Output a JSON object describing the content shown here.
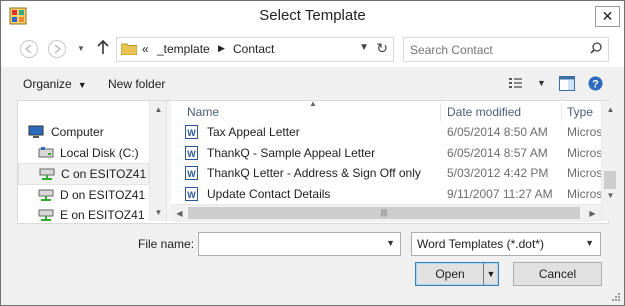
{
  "window": {
    "title": "Select Template",
    "close_glyph": "✕"
  },
  "nav": {
    "back_icon": "back-arrow-icon",
    "forward_icon": "forward-arrow-icon",
    "up_icon": "up-arrow-icon",
    "breadcrumb": [
      "«",
      "_template",
      "Contact"
    ],
    "search_placeholder": "Search Contact"
  },
  "toolbar": {
    "organize_label": "Organize",
    "new_folder_label": "New folder"
  },
  "navpane": {
    "items": [
      {
        "label": "Computer",
        "icon": "computer-icon"
      },
      {
        "label": "Local Disk (C:)",
        "icon": "drive-icon"
      },
      {
        "label": "C on ESITOZ41",
        "icon": "network-drive-icon",
        "selected": true
      },
      {
        "label": "D on ESITOZ41",
        "icon": "network-drive-icon"
      },
      {
        "label": "E on ESITOZ41",
        "icon": "network-drive-icon"
      }
    ]
  },
  "filelist": {
    "columns": [
      "Name",
      "Date modified",
      "Type"
    ],
    "rows": [
      {
        "name": "Tax Appeal Letter",
        "date": "6/05/2014 8:50 AM",
        "type": "Micros"
      },
      {
        "name": "ThankQ - Sample Appeal Letter",
        "date": "6/05/2014 8:57 AM",
        "type": "Micros"
      },
      {
        "name": "ThankQ Letter - Address & Sign Off only",
        "date": "5/03/2012 4:42 PM",
        "type": "Micros"
      },
      {
        "name": "Update Contact Details",
        "date": "9/11/2007 11:27 AM",
        "type": "Micros"
      }
    ]
  },
  "footer": {
    "file_name_label": "File name:",
    "file_name_value": "",
    "filter_value": "Word Templates (*.dot*)",
    "open_label": "Open",
    "cancel_label": "Cancel"
  },
  "colors": {
    "header_text": "#4c607a",
    "accent_border": "#3c7fb1",
    "word_icon": "#2b5797"
  }
}
